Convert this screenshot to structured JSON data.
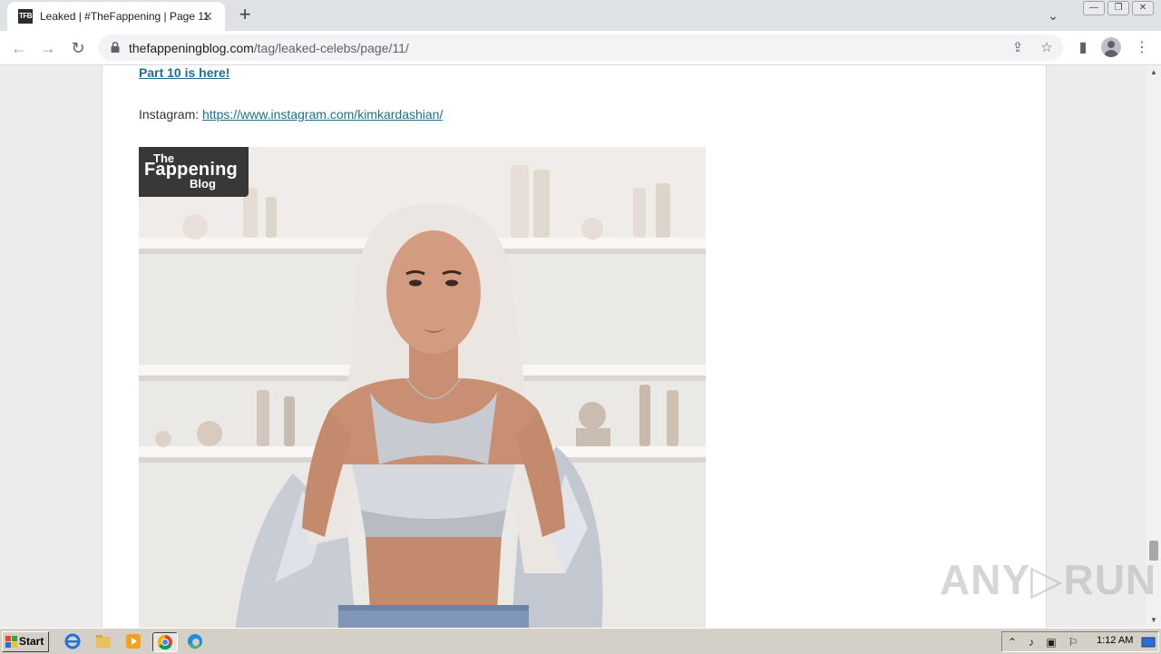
{
  "browser": {
    "tab": {
      "favicon_text": "TFB",
      "title": "Leaked | #TheFappening | Page 11",
      "close_glyph": "✕"
    },
    "new_tab_glyph": "+",
    "tab_search_glyph": "⌄",
    "window_controls": [
      "—",
      "❐",
      "✕"
    ],
    "nav": {
      "back": "←",
      "forward": "→",
      "reload": "↻"
    },
    "address": {
      "domain": "thefappeningblog.com",
      "path": "/tag/leaked-celebs/page/11/"
    },
    "toolbar_icons": {
      "share": "⇪",
      "bookmark": "☆",
      "sidepanel": "▮",
      "menu": "⋮"
    }
  },
  "page": {
    "part_link": "Part 10 is here!",
    "instagram_label": "Instagram: ",
    "instagram_url": "https://www.instagram.com/kimkardashian/",
    "logo": {
      "line1": "The",
      "line2": "Fappening",
      "line3": "Blog"
    }
  },
  "scrollbar": {
    "up": "▲",
    "down": "▼"
  },
  "watermark": "ANY▷RUN",
  "taskbar": {
    "start_label": "Start",
    "clock": "1:12 AM"
  },
  "colors": {
    "link": "#1f6f8b",
    "page_bg": "#ececec",
    "taskbar": "#d4d0c8",
    "chrome_tabstrip": "#dee1e6"
  }
}
